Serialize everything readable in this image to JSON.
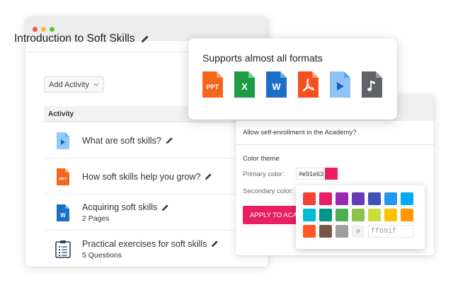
{
  "window": {
    "title": "Introduction to Soft Skills",
    "traffic_lights": [
      "#ee5a52",
      "#f5b939",
      "#5bc236"
    ]
  },
  "toolbar": {
    "add_activity_label": "Add Activity"
  },
  "table": {
    "header": "Activity",
    "rows": [
      {
        "icon": "video-file-icon",
        "name": "What are soft skills?",
        "sub": ""
      },
      {
        "icon": "ppt-file-icon",
        "name": "How soft skills help you grow?",
        "sub": ""
      },
      {
        "icon": "word-file-icon",
        "name": "Acquiring soft skills",
        "sub": "2 Pages"
      },
      {
        "icon": "clipboard-icon",
        "name": "Practical exercises for soft skills",
        "sub": "5 Questions"
      }
    ]
  },
  "formats": {
    "title": "Supports almost all formats",
    "items": [
      {
        "icon": "ppt-file-icon",
        "label": "PPT",
        "color": "#f4661b"
      },
      {
        "icon": "excel-file-icon",
        "label": "X",
        "color": "#1e9b45"
      },
      {
        "icon": "word-file-icon",
        "label": "W",
        "color": "#1a6fc9"
      },
      {
        "icon": "pdf-file-icon",
        "label": "",
        "color": "#f4511e"
      },
      {
        "icon": "video-file-icon",
        "label": "",
        "color": "#8fc3f5"
      },
      {
        "icon": "audio-file-icon",
        "label": "",
        "color": "#5f6368"
      }
    ]
  },
  "settings": {
    "enroll_text": "Allow self-enrollment in the Academy?",
    "color_theme_label": "Color theme",
    "primary_label": "Primary color:",
    "primary_value": "#e91e63",
    "secondary_label": "Secondary color:",
    "apply_label": "APPLY TO ACADEMY"
  },
  "palette": {
    "colors": [
      "#f44336",
      "#e91e63",
      "#9c27b0",
      "#673ab7",
      "#3f51b5",
      "#2196f3",
      "#03a9f4",
      "#00bcd4",
      "#009688",
      "#4caf50",
      "#8bc34a",
      "#cddc39",
      "#ffc107",
      "#ff9800",
      "#ff5722",
      "#795548",
      "#9e9e9e"
    ],
    "hash": "#",
    "hex_value": "ff691f"
  }
}
